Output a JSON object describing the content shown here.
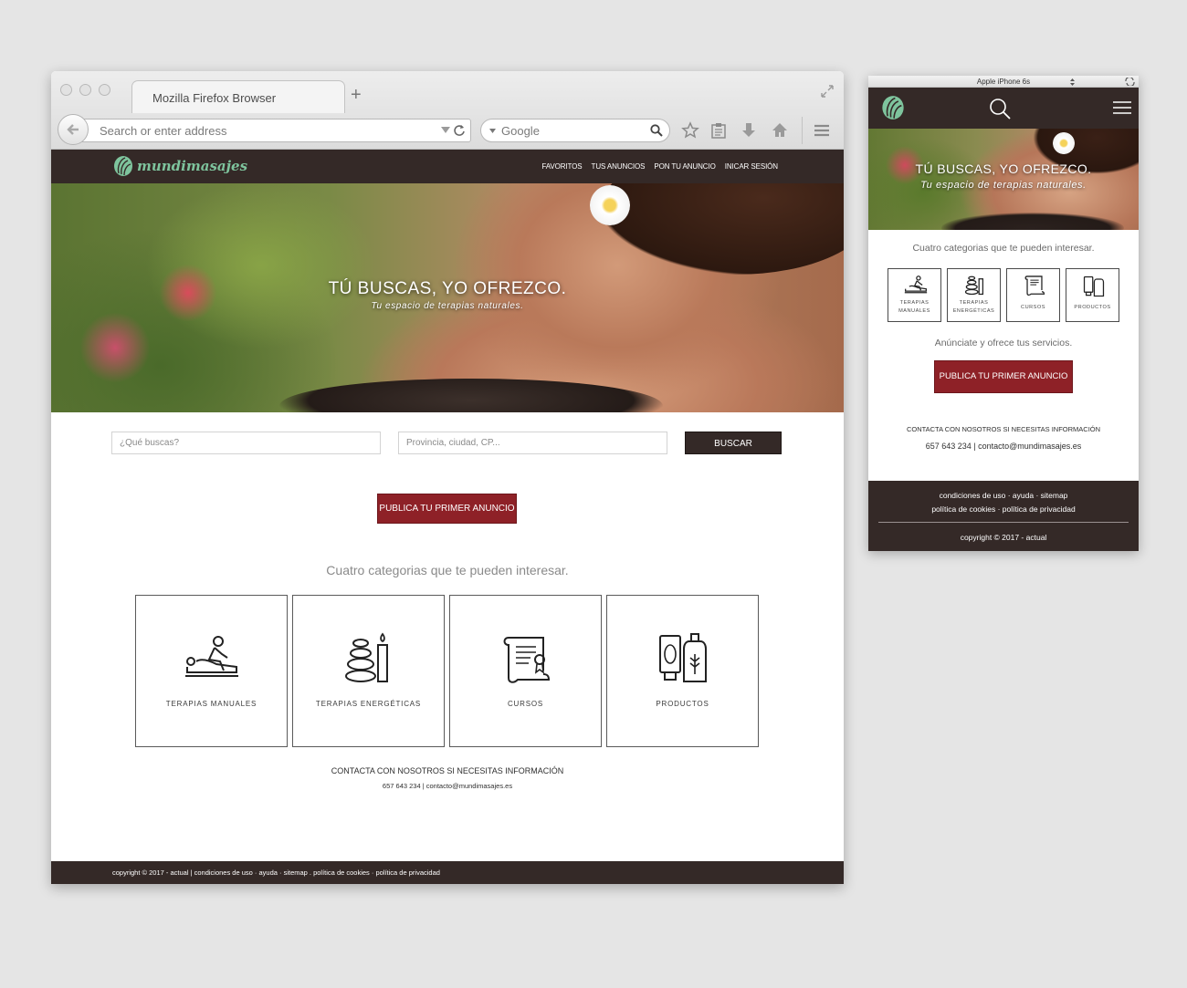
{
  "browser": {
    "tab_title": "Mozilla Firefox Browser",
    "address_placeholder": "Search or enter address",
    "search_placeholder": "Google"
  },
  "site": {
    "logo_text": "mundimasajes",
    "nav": [
      "FAVORITOS",
      "TUS ANUNCIOS",
      "PON TU ANUNCIO",
      "INICAR SESIÓN"
    ],
    "hero_title": "TÚ BUSCAS, YO OFREZCO.",
    "hero_subtitle": "Tu espacio de terapias naturales.",
    "search": {
      "what_placeholder": "¿Qué buscas?",
      "where_placeholder": "Provincia, ciudad, CP...",
      "button": "BUSCAR"
    },
    "publish_button": "PUBLICA TU PRIMER ANUNCIO",
    "categories_heading": "Cuatro categorias que te pueden interesar.",
    "categories": [
      {
        "label": "TERAPIAS MANUALES",
        "icon": "massage-icon"
      },
      {
        "label": "TERAPIAS ENERGÉTICAS",
        "icon": "stones-candle-icon"
      },
      {
        "label": "CURSOS",
        "icon": "diploma-scroll-icon"
      },
      {
        "label": "PRODUCTOS",
        "icon": "bottles-icon"
      }
    ],
    "contact_title": "CONTACTA CON NOSOTROS SI NECESITAS INFORMACIÓN",
    "contact_details": "657 643 234 | contacto@mundimasajes.es",
    "footer": "copyright © 2017 - actual  |  condiciones de uso · ayuda · sitemap . política de cookies · política de privacidad"
  },
  "mobile": {
    "device_title": "Apple iPhone 6s",
    "hero_title": "TÚ BUSCAS, YO OFREZCO.",
    "hero_subtitle": "Tu espacio de terapias naturales.",
    "categories_heading": "Cuatro categorias que te pueden interesar.",
    "categories": [
      {
        "label": "TERAPIAS MANUALES"
      },
      {
        "label": "TERAPIAS ENERGÉTICAS"
      },
      {
        "label": "CURSOS"
      },
      {
        "label": "PRODUCTOS"
      }
    ],
    "cta_text": "Anúnciate y ofrece tus servicios.",
    "publish_button": "PUBLICA TU PRIMER ANUNCIO",
    "contact_title": "CONTACTA CON NOSOTROS SI NECESITAS INFORMACIÓN",
    "contact_details": "657 643 234 | contacto@mundimasajes.es",
    "footer_line1": "condiciones de uso · ayuda · sitemap",
    "footer_line2": "política de cookies · política de privacidad",
    "copyright": "copyright © 2017 - actual"
  },
  "colors": {
    "brand_dark": "#342927",
    "brand_red": "#8e2127",
    "logo_green": "#7ec49d"
  }
}
